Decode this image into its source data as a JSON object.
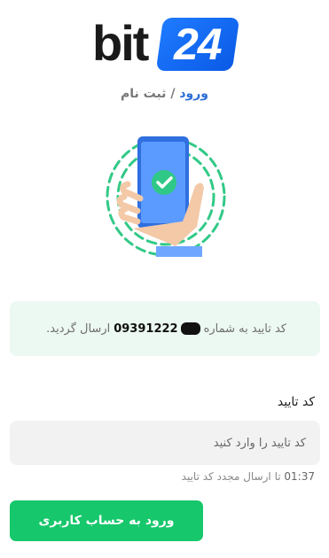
{
  "logo": {
    "text": "bit",
    "number": "24"
  },
  "auth_links": {
    "login": "ورود",
    "separator": "/",
    "signup": "ثبت نام"
  },
  "notice": {
    "prefix": "کد تایید به شماره",
    "phone": "09391222",
    "suffix": "ارسال گردید."
  },
  "verification": {
    "label": "کد تایید",
    "placeholder": "کد تایید را وارد کنید",
    "timer_seconds": "01:37",
    "timer_text": "تا ارسال مجدد کد تایید"
  },
  "submit_label": "ورود به حساب کاربری",
  "colors": {
    "brand": "#1f7bff",
    "primary_button": "#16c76b",
    "notice_bg": "#ecf8f2",
    "link": "#2e6ed6"
  },
  "icons": [
    "phone-verified-illustration",
    "check-icon"
  ]
}
